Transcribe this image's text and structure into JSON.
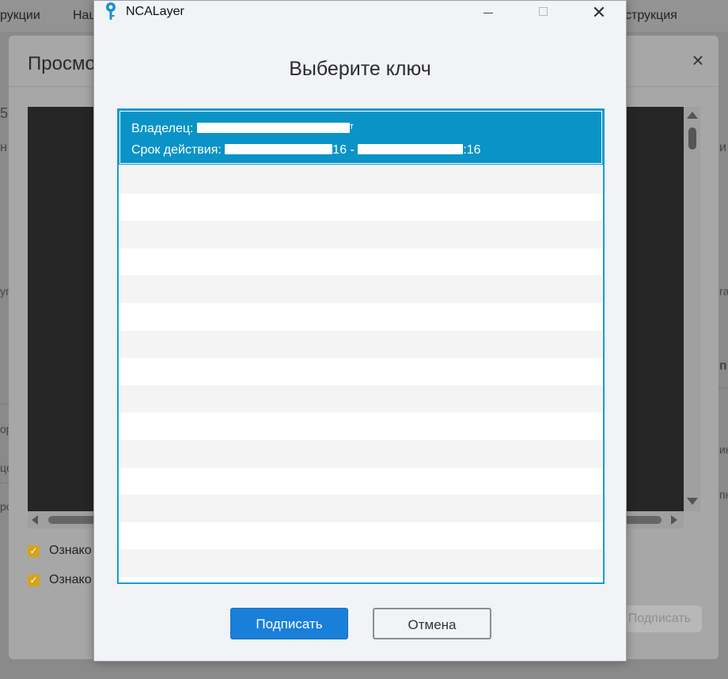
{
  "background": {
    "topbar_items": [
      "рукции",
      "Нац",
      "струкция"
    ],
    "modal_title": "Просмо",
    "close_icon": "close-icon",
    "checkbox_labels": [
      "Ознако",
      "Ознако"
    ],
    "sign_button_label": "Подписать",
    "left_edge_glyphs": [
      "5(",
      "н",
      "уг",
      "ор",
      "це",
      "ро"
    ],
    "right_edge_glyphs": [
      "и",
      "га",
      "п",
      "ин",
      "пн"
    ]
  },
  "dialog": {
    "app_title": "NCALayer",
    "app_icon": "key-pin-icon",
    "heading": "Выберите ключ",
    "keys": [
      {
        "owner_label": "Владелец:",
        "owner_tail": "т",
        "validity_label": "Срок действия:",
        "validity_from_tail": "16",
        "separator": "-",
        "validity_to_tail": ":16",
        "selected": true
      }
    ],
    "buttons": {
      "sign": "Подписать",
      "cancel": "Отмена"
    },
    "colors": {
      "selected_row": "#0a93c6",
      "list_border": "#1a9bd0",
      "primary_button": "#1a7fd8"
    }
  }
}
